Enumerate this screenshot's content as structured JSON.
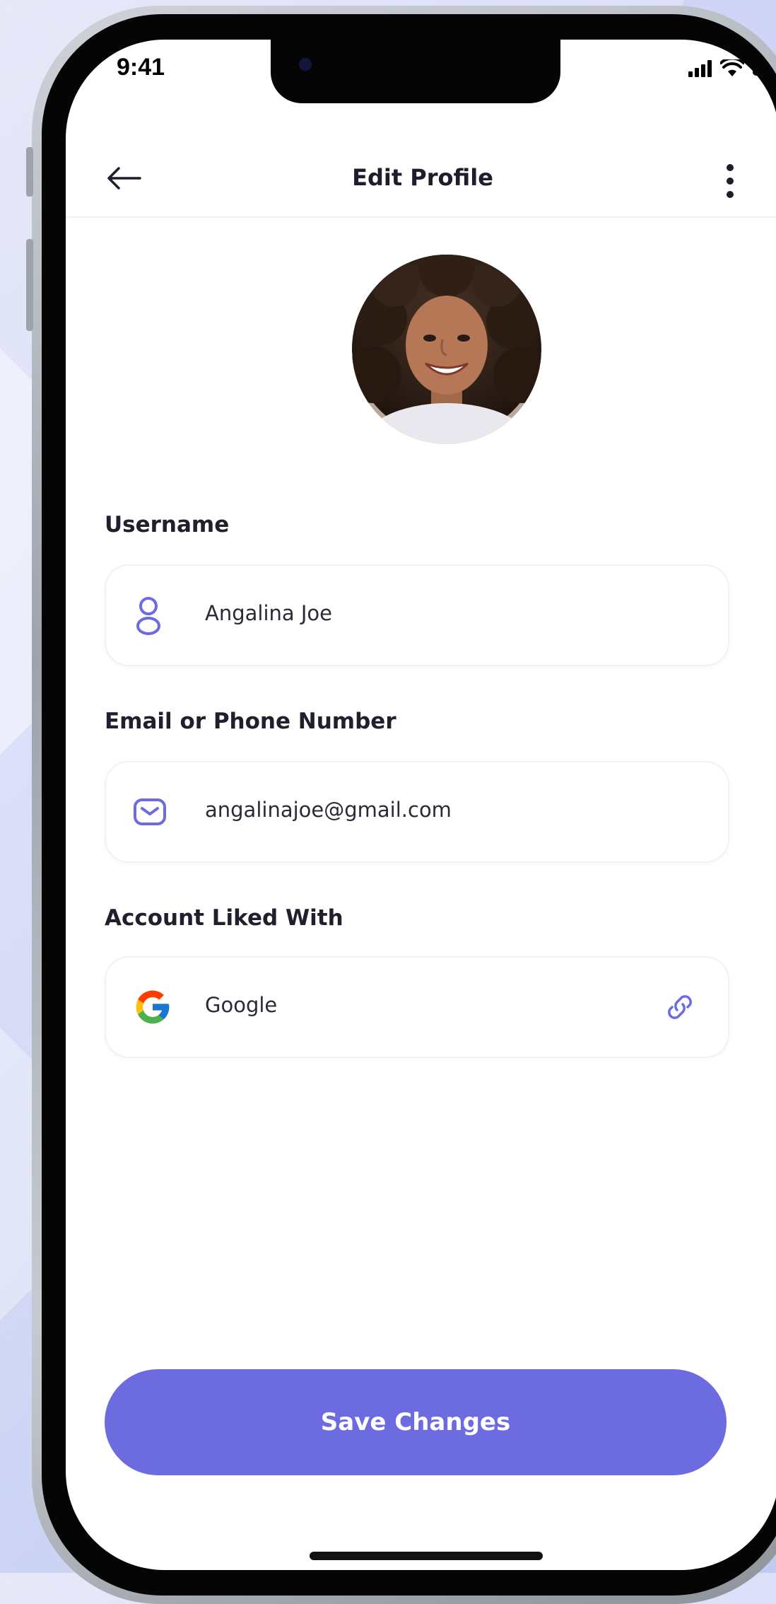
{
  "status_bar": {
    "time": "9:41"
  },
  "header": {
    "title": "Edit Profile",
    "back_icon": "arrow-left-icon",
    "more_icon": "more-vertical-icon"
  },
  "profile": {
    "avatar": "profile-photo"
  },
  "form": {
    "username": {
      "label": "Username",
      "value": "Angalina Joe",
      "icon": "user-icon"
    },
    "email": {
      "label": "Email or Phone Number",
      "value": "angalinajoe@gmail.com",
      "icon": "mail-icon"
    },
    "linked_account": {
      "label": "Account Liked With",
      "value": "Google",
      "icon": "google-icon",
      "action_icon": "link-icon"
    }
  },
  "actions": {
    "save_label": "Save Changes"
  },
  "colors": {
    "accent": "#6c6ce0",
    "text": "#1d1d2c",
    "field_border": "#f1f1f6"
  }
}
